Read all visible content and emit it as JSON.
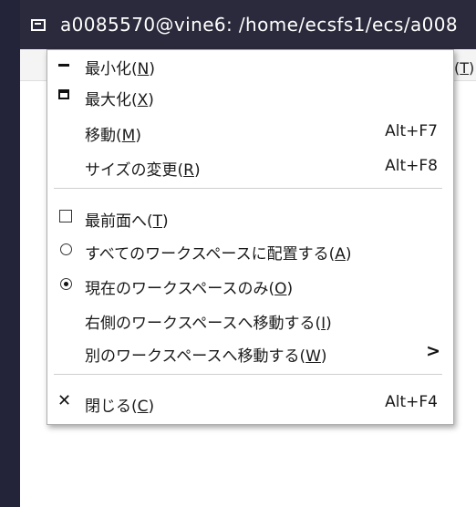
{
  "window": {
    "title": "a0085570@vine6: /home/ecsfs1/ecs/a008",
    "menubar_partial": {
      "prefix": "ミ(",
      "mnemonic": "T",
      "suffix": ")"
    }
  },
  "menu": {
    "minimize": {
      "label": "最小化(",
      "mnemonic": "N",
      "suffix": ")"
    },
    "maximize": {
      "label": "最大化(",
      "mnemonic": "X",
      "suffix": ")"
    },
    "move": {
      "label": "移動(",
      "mnemonic": "M",
      "suffix": ")",
      "accel": "Alt+F7"
    },
    "resize": {
      "label": "サイズの変更(",
      "mnemonic": "R",
      "suffix": ")",
      "accel": "Alt+F8"
    },
    "always_on_top": {
      "label": "最前面へ(",
      "mnemonic": "T",
      "suffix": ")",
      "checked": false
    },
    "all_workspaces": {
      "label": "すべてのワークスペースに配置する(",
      "mnemonic": "A",
      "suffix": ")",
      "selected": false
    },
    "this_workspace": {
      "label": "現在のワークスペースのみ(",
      "mnemonic": "O",
      "suffix": ")",
      "selected": true
    },
    "move_right": {
      "label": "右側のワークスペースへ移動する(",
      "mnemonic": "I",
      "suffix": ")"
    },
    "move_other": {
      "label": "別のワークスペースへ移動する(",
      "mnemonic": "W",
      "suffix": ")",
      "submenu_icon": "chevron-right-icon"
    },
    "close": {
      "label": "閉じる(",
      "mnemonic": "C",
      "suffix": ")",
      "accel": "Alt+F4",
      "icon": "close-icon"
    }
  }
}
